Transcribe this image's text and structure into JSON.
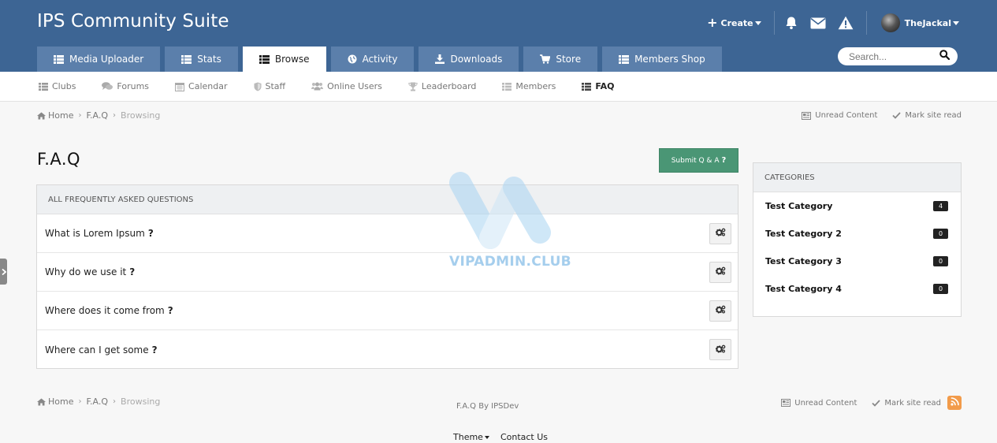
{
  "header": {
    "site_title": "IPS Community Suite",
    "create_label": "Create",
    "username": "TheJackal",
    "search_placeholder": "Search..."
  },
  "main_tabs": [
    {
      "label": "Media Uploader",
      "icon": "list-icon",
      "active": false
    },
    {
      "label": "Stats",
      "icon": "list-icon",
      "active": false
    },
    {
      "label": "Browse",
      "icon": "list-icon",
      "active": true
    },
    {
      "label": "Activity",
      "icon": "globe-icon",
      "active": false
    },
    {
      "label": "Downloads",
      "icon": "download-icon",
      "active": false
    },
    {
      "label": "Store",
      "icon": "cart-icon",
      "active": false
    },
    {
      "label": "Members Shop",
      "icon": "list-icon",
      "active": false
    }
  ],
  "subnav": [
    {
      "label": "Clubs",
      "icon": "list-icon"
    },
    {
      "label": "Forums",
      "icon": "comments-icon"
    },
    {
      "label": "Calendar",
      "icon": "calendar-icon"
    },
    {
      "label": "Staff",
      "icon": "shield-icon"
    },
    {
      "label": "Online Users",
      "icon": "users-icon"
    },
    {
      "label": "Leaderboard",
      "icon": "trophy-icon"
    },
    {
      "label": "Members",
      "icon": "list-icon"
    },
    {
      "label": "FAQ",
      "icon": "list-icon",
      "active": true
    }
  ],
  "breadcrumb": {
    "home": "Home",
    "section": "F.A.Q",
    "current": "Browsing",
    "unread": "Unread Content",
    "mark_read": "Mark site read"
  },
  "page": {
    "title": "F.A.Q",
    "submit_label": "Submit Q & A",
    "submit_icon": "?"
  },
  "faq_box": {
    "header": "ALL FREQUENTLY ASKED QUESTIONS",
    "questions": [
      "What is Lorem Ipsum",
      "Why do we use it",
      "Where does it come from",
      "Where can I get some"
    ],
    "question_mark": "?"
  },
  "categories": {
    "header": "CATEGORIES",
    "items": [
      {
        "name": "Test Category",
        "count": "4"
      },
      {
        "name": "Test Category 2",
        "count": "0"
      },
      {
        "name": "Test Category 3",
        "count": "0"
      },
      {
        "name": "Test Category 4",
        "count": "0"
      }
    ]
  },
  "watermark": "VIPADMIN.CLUB",
  "footer": {
    "credit": "F.A.Q By IPSDev",
    "theme_label": "Theme",
    "contact_label": "Contact Us"
  },
  "colors": {
    "header_bg": "#3d6594",
    "tab_bg": "#5b7fab",
    "submit_bg": "#4a9675",
    "rss": "#f29b4a"
  }
}
